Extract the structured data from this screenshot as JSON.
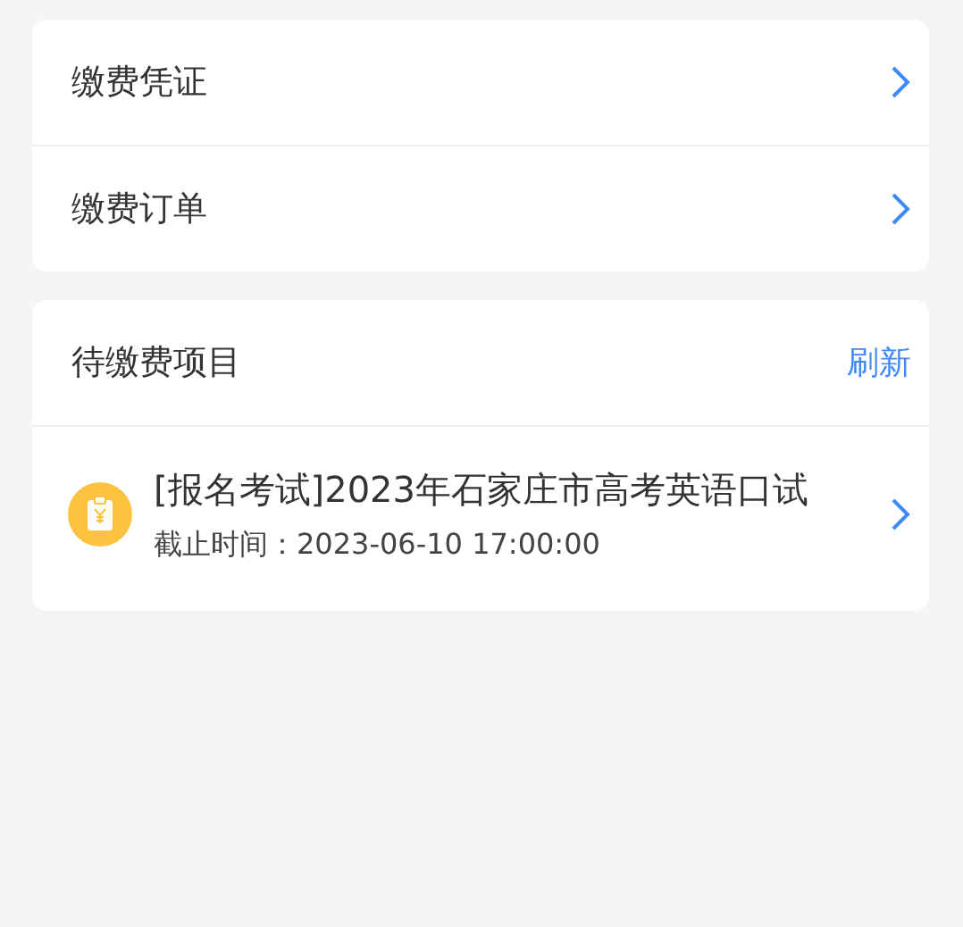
{
  "menu": [
    {
      "label": "缴费凭证"
    },
    {
      "label": "缴费订单"
    }
  ],
  "pending": {
    "title": "待缴费项目",
    "refresh": "刷新",
    "items": [
      {
        "title": "[报名考试]2023年石家庄市高考英语口试",
        "deadline": "截止时间：2023-06-10 17:00:00"
      }
    ]
  }
}
